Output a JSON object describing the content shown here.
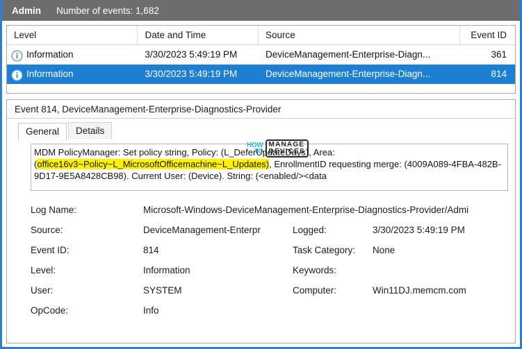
{
  "header": {
    "channel": "Admin",
    "events_count_label": "Number of events: 1,682"
  },
  "events_table": {
    "columns": [
      "Level",
      "Date and Time",
      "Source",
      "Event ID"
    ],
    "rows": [
      {
        "icon": "information-icon",
        "level": "Information",
        "datetime": "3/30/2023 5:49:19 PM",
        "source": "DeviceManagement-Enterprise-Diagn...",
        "event_id": "361",
        "selected": false
      },
      {
        "icon": "information-icon",
        "level": "Information",
        "datetime": "3/30/2023 5:49:19 PM",
        "source": "DeviceManagement-Enterprise-Diagn...",
        "event_id": "814",
        "selected": true
      }
    ]
  },
  "detail": {
    "title": "Event 814, DeviceManagement-Enterprise-Diagnostics-Provider",
    "tabs": [
      {
        "label": "General",
        "active": true
      },
      {
        "label": "Details",
        "active": false
      }
    ],
    "message": {
      "part1": "MDM PolicyManager: Set policy string, Policy: (L_DeferUpdateDays), Area: (",
      "highlight1": "office16v3",
      "part2": "",
      "highlight2": "~Policy~L_MicrosoftOfficemachine~L_Updates)",
      "part3": ", EnrollmentID requesting merge: (4009A089-4FBA-482B-9D17-9E5A8428CB98). Current User: (Device). String: (<enabled/><data"
    },
    "properties": [
      {
        "label": "Log Name:",
        "value": "Microsoft-Windows-DeviceManagement-Enterprise-Diagnostics-Provider/Admi",
        "label2": "",
        "value2": ""
      },
      {
        "label": "Source:",
        "value": "DeviceManagement-Enterpr",
        "label2": "Logged:",
        "value2": "3/30/2023 5:49:19 PM"
      },
      {
        "label": "Event ID:",
        "value": "814",
        "label2": "Task Category:",
        "value2": "None"
      },
      {
        "label": "Level:",
        "value": "Information",
        "label2": "Keywords:",
        "value2": ""
      },
      {
        "label": "User:",
        "value": "SYSTEM",
        "label2": "Computer:",
        "value2": "Win11DJ.memcm.com"
      },
      {
        "label": "OpCode:",
        "value": "Info",
        "label2": "",
        "value2": ""
      }
    ]
  },
  "watermark": {
    "how": "HOW",
    "to": "TO",
    "manage": "MANAGE",
    "devices": "DEVICES"
  },
  "colors": {
    "header_bar": "#6d6d6d",
    "selection": "#1d7fd4",
    "highlight": "#fff200",
    "window_border": "#2a7fd4",
    "watermark_cyan": "#22b3e0"
  }
}
